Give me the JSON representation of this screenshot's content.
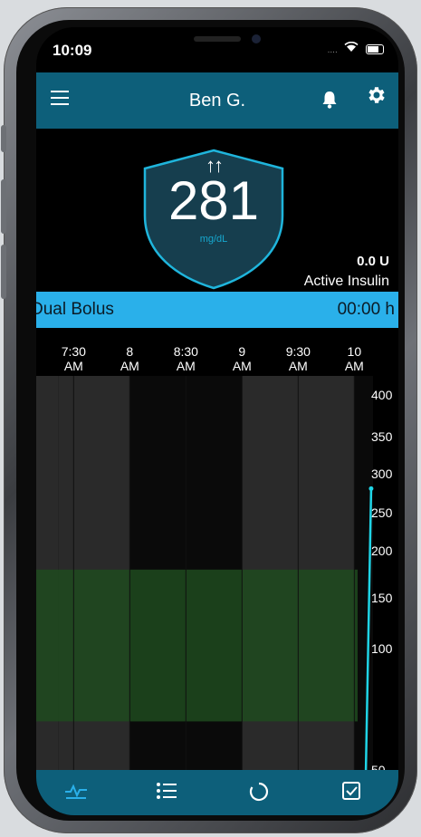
{
  "status_bar": {
    "time": "10:09",
    "signal": "....",
    "wifi_icon": "wifi-icon",
    "battery_icon": "battery-icon"
  },
  "header": {
    "title": "Ben G.",
    "menu_icon": "hamburger-menu-icon",
    "alarm_icon": "bell-icon",
    "settings_icon": "gear-icon"
  },
  "glucose": {
    "trend_arrows": "↑↑",
    "value": "281",
    "unit": "mg/dL"
  },
  "insulin": {
    "value": "0.0 U",
    "label": "Active Insulin"
  },
  "bolus": {
    "name": "Dual Bolus",
    "remaining": "00:00 h"
  },
  "colors": {
    "header": "#0d5f7a",
    "accent": "#2ab0ea",
    "target_band": "#1f4a1f",
    "line": "#1fd4e6"
  },
  "chart_data": {
    "type": "line",
    "x_ticks": [
      "7:30 AM",
      "8 AM",
      "8:30 AM",
      "9 AM",
      "9:30 AM",
      "10 AM"
    ],
    "y_ticks": [
      400,
      350,
      300,
      250,
      200,
      150,
      100,
      50
    ],
    "target_range": [
      70,
      180
    ],
    "series": [
      {
        "points": [
          {
            "x": "10:06",
            "y": 40
          },
          {
            "x": "10:09",
            "y": 281
          }
        ]
      }
    ]
  },
  "tabs": [
    {
      "icon": "trend-chart-icon",
      "active": true
    },
    {
      "icon": "list-icon",
      "active": false
    },
    {
      "icon": "circle-progress-icon",
      "active": false
    },
    {
      "icon": "checkbox-icon",
      "active": false
    }
  ]
}
